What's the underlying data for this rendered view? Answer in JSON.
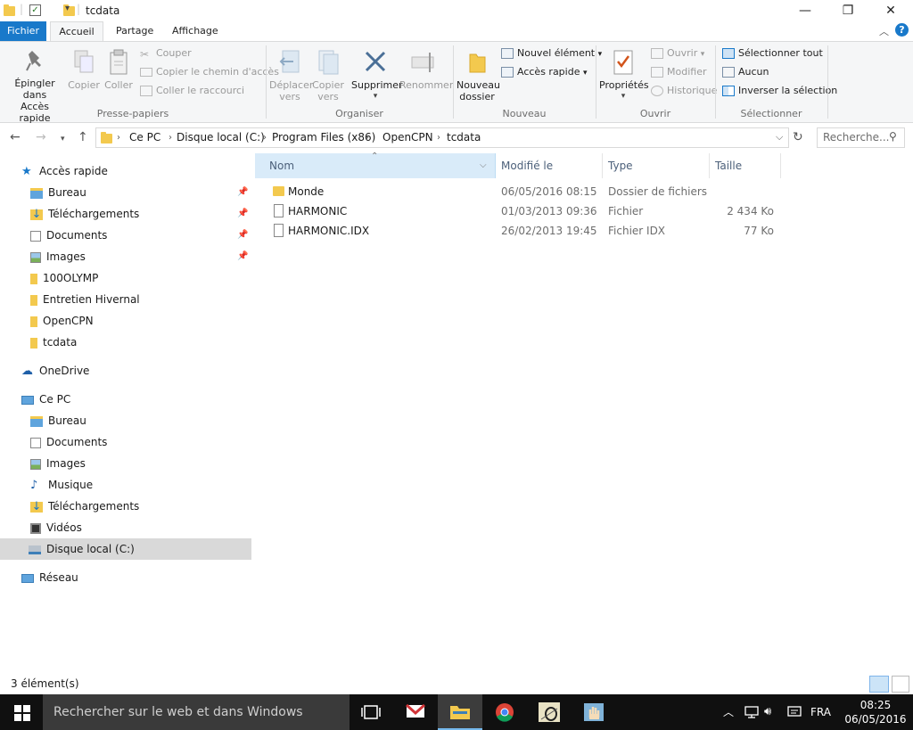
{
  "window": {
    "title": "tcdata",
    "minimize": "—",
    "maximize": "❐",
    "close": "✕"
  },
  "ribbon_tabs": [
    "Fichier",
    "Accueil",
    "Partage",
    "Affichage"
  ],
  "ribbon": {
    "pin_label_1": "Épingler dans",
    "pin_label_2": "Accès rapide",
    "copy": "Copier",
    "paste": "Coller",
    "cut": "Couper",
    "copy_path": "Copier le chemin d'accès",
    "paste_shortcut": "Coller le raccourci",
    "clipboard_group": "Presse-papiers",
    "move_to_1": "Déplacer",
    "move_to_2": "vers",
    "copy_to_1": "Copier",
    "copy_to_2": "vers",
    "delete": "Supprimer",
    "rename": "Renommer",
    "organize_group": "Organiser",
    "new_folder_1": "Nouveau",
    "new_folder_2": "dossier",
    "new_item": "Nouvel élément",
    "easy_access": "Accès rapide",
    "new_group": "Nouveau",
    "properties": "Propriétés",
    "open": "Ouvrir",
    "edit": "Modifier",
    "history": "Historique",
    "open_group": "Ouvrir",
    "select_all": "Sélectionner tout",
    "select_none": "Aucun",
    "invert_selection": "Inverser la sélection",
    "select_group": "Sélectionner"
  },
  "address": {
    "crumbs": [
      "Ce PC",
      "Disque local (C:)",
      "Program Files (x86)",
      "OpenCPN",
      "tcdata"
    ],
    "search_placeholder": "Recherche..."
  },
  "nav": {
    "quick_access": "Accès rapide",
    "quick_items": [
      "Bureau",
      "Téléchargements",
      "Documents",
      "Images",
      "100OLYMP",
      "Entretien Hivernal",
      "OpenCPN",
      "tcdata"
    ],
    "onedrive": "OneDrive",
    "this_pc": "Ce PC",
    "pc_items": [
      "Bureau",
      "Documents",
      "Images",
      "Musique",
      "Téléchargements",
      "Vidéos",
      "Disque local (C:)"
    ],
    "network": "Réseau"
  },
  "columns": [
    "Nom",
    "Modifié le",
    "Type",
    "Taille"
  ],
  "files": [
    {
      "name": "Monde",
      "modified": "06/05/2016 08:15",
      "type": "Dossier de fichiers",
      "size": ""
    },
    {
      "name": "HARMONIC",
      "modified": "01/03/2013 09:36",
      "type": "Fichier",
      "size": "2 434 Ko"
    },
    {
      "name": "HARMONIC.IDX",
      "modified": "26/02/2013 19:45",
      "type": "Fichier IDX",
      "size": "77 Ko"
    }
  ],
  "status": {
    "count": "3 élément(s)"
  },
  "taskbar": {
    "search_text": "Rechercher sur le web et dans Windows",
    "lang": "FRA",
    "time": "08:25",
    "date": "06/05/2016"
  },
  "colors": {
    "accent": "#1979ca",
    "folder": "#f3c94e",
    "selection": "#d9d9d9",
    "column_highlight": "#d9ebf9",
    "taskbar": "#101010"
  }
}
